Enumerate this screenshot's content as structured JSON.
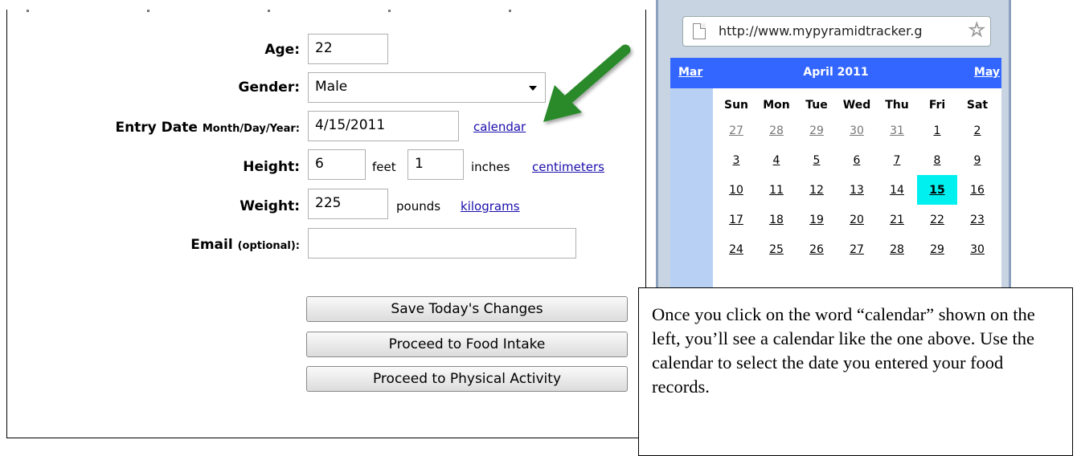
{
  "form": {
    "age": {
      "label": "Age:",
      "value": "22"
    },
    "gender": {
      "label": "Gender:",
      "value": "Male"
    },
    "entry_date": {
      "label": "Entry Date",
      "format_label": "Month/Day/Year:",
      "value": "4/15/2011",
      "calendar_link": "calendar"
    },
    "height": {
      "label": "Height:",
      "feet_value": "6",
      "feet_unit": "feet",
      "inches_value": "1",
      "inches_unit": "inches",
      "centimeters_link": "centimeters"
    },
    "weight": {
      "label": "Weight:",
      "value": "225",
      "unit": "pounds",
      "kilograms_link": "kilograms"
    },
    "email": {
      "label": "Email",
      "optional_label": "(optional):",
      "value": ""
    },
    "buttons": {
      "save": "Save Today's Changes",
      "food_intake": "Proceed to Food Intake",
      "physical_activity": "Proceed to Physical Activity"
    }
  },
  "calendar_popup": {
    "url": "http://www.mypyramidtracker.g",
    "prev_month": "Mar",
    "month_title": "April 2011",
    "next_month": "May",
    "weekdays": [
      "Sun",
      "Mon",
      "Tue",
      "Wed",
      "Thu",
      "Fri",
      "Sat"
    ],
    "weeks": [
      [
        "27",
        "28",
        "29",
        "30",
        "31",
        "1",
        "2"
      ],
      [
        "3",
        "4",
        "5",
        "6",
        "7",
        "8",
        "9"
      ],
      [
        "10",
        "11",
        "12",
        "13",
        "14",
        "15",
        "16"
      ],
      [
        "17",
        "18",
        "19",
        "20",
        "21",
        "22",
        "23"
      ],
      [
        "24",
        "25",
        "26",
        "27",
        "28",
        "29",
        "30"
      ]
    ],
    "selected_day": "15",
    "highlight_color": "#00f0f0",
    "header_color": "#3366ff"
  },
  "note": {
    "text": "Once you click on the word “calendar” shown on the left, you’ll see a calendar like the one above.  Use the calendar to select the date you entered your food records."
  },
  "arrow": {
    "color": "#2a8a2a",
    "icon": "arrow-icon"
  }
}
